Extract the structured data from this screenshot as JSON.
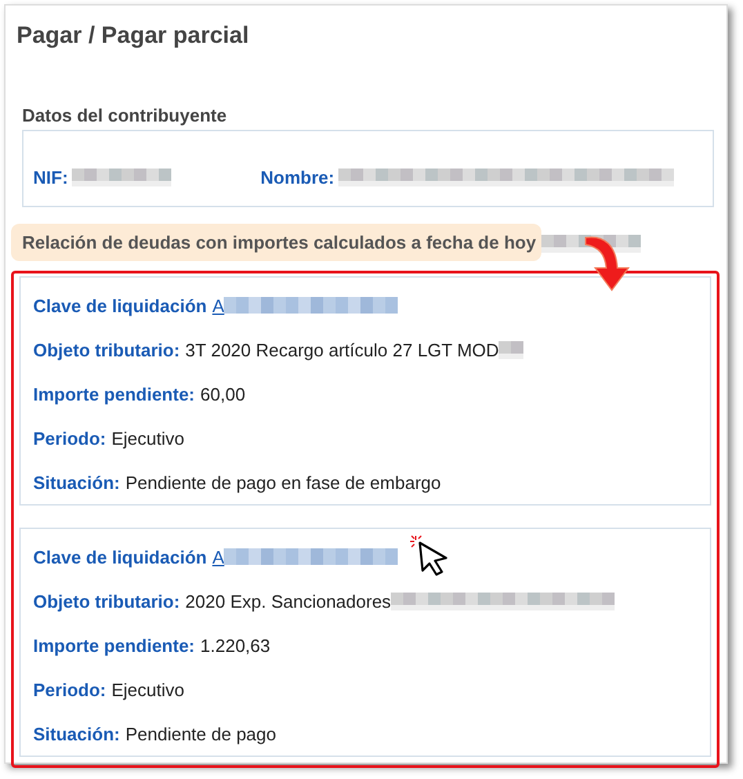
{
  "title": "Pagar / Pagar parcial",
  "taxpayer": {
    "heading": "Datos del contribuyente",
    "fields": [
      {
        "label": "NIF:",
        "redacted": true
      },
      {
        "label": "Nombre:",
        "redacted": true
      }
    ]
  },
  "debts_banner": {
    "text": "Relación de deudas con importes calculados a fecha de hoy",
    "redacted": true
  },
  "debts": [
    {
      "fields": [
        {
          "kind": "link",
          "label": "Clave de liquidación",
          "value": "A",
          "redacted": true
        },
        {
          "kind": "text",
          "label": "Objeto tributario:",
          "value": "3T 2020 Recargo artículo 27 LGT MOD",
          "redacted": true
        },
        {
          "kind": "text",
          "label": "Importe pendiente:",
          "value": "60,00",
          "redacted": false
        },
        {
          "kind": "text",
          "label": "Periodo:",
          "value": "Ejecutivo",
          "redacted": false
        },
        {
          "kind": "text",
          "label": "Situación:",
          "value": "Pendiente de pago en fase de embargo",
          "redacted": false
        }
      ],
      "pointer": false
    },
    {
      "fields": [
        {
          "kind": "link",
          "label": "Clave de liquidación",
          "value": "A",
          "redacted": true
        },
        {
          "kind": "text",
          "label": "Objeto tributario:",
          "value": "2020 Exp. Sancionadores",
          "redacted": true
        },
        {
          "kind": "text",
          "label": "Importe pendiente:",
          "value": "1.220,63",
          "redacted": false
        },
        {
          "kind": "text",
          "label": "Periodo:",
          "value": "Ejecutivo",
          "redacted": false
        },
        {
          "kind": "text",
          "label": "Situación:",
          "value": "Pendiente de pago",
          "redacted": false
        }
      ],
      "pointer": true
    }
  ]
}
